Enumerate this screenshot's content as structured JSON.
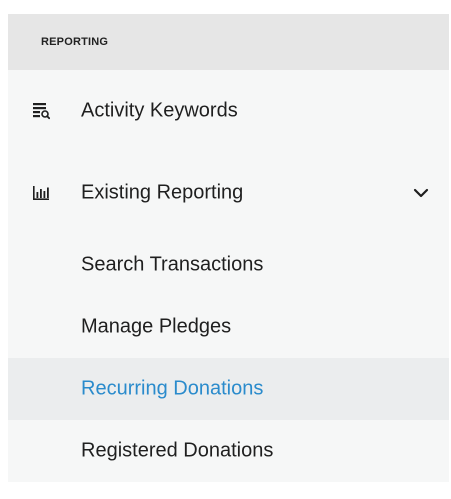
{
  "sidebar": {
    "section_title": "REPORTING",
    "items": [
      {
        "label": "Activity Keywords",
        "icon": "search-list-icon"
      },
      {
        "label": "Existing Reporting",
        "icon": "bar-chart-icon",
        "expanded": true,
        "chevron_icon": "chevron-down-icon",
        "subitems": [
          {
            "label": "Search Transactions",
            "active": false
          },
          {
            "label": "Manage Pledges",
            "active": false
          },
          {
            "label": "Recurring Donations",
            "active": true
          },
          {
            "label": "Registered Donations",
            "active": false
          }
        ]
      }
    ]
  },
  "colors": {
    "header_bg": "#e6e6e6",
    "item_bg": "#f6f7f7",
    "active_bg": "#ebedee",
    "active_text": "#2a8bcc"
  }
}
